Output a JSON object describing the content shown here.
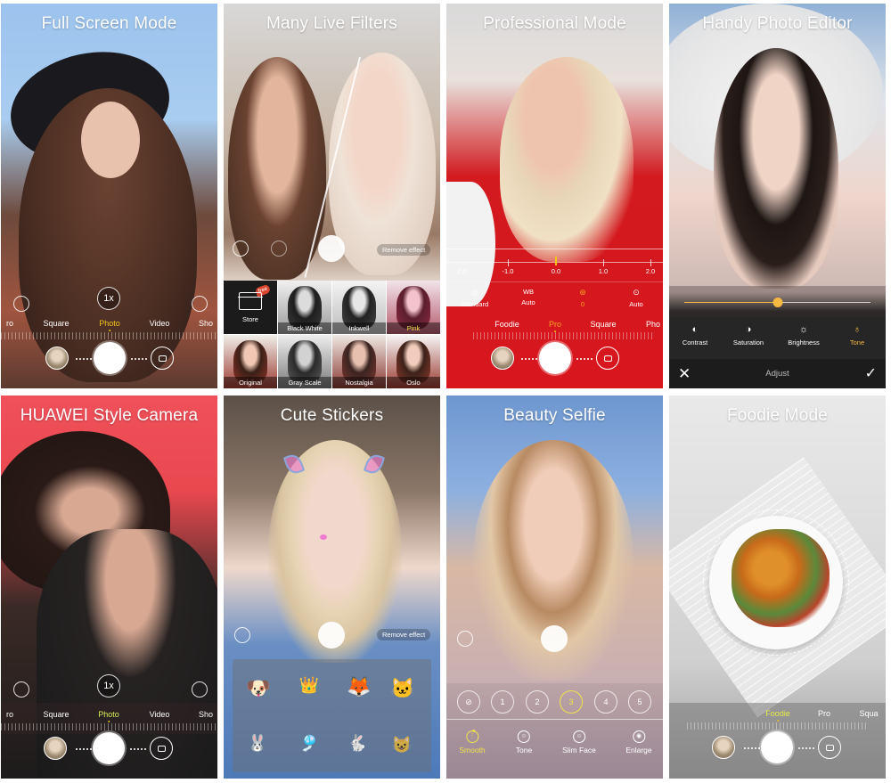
{
  "panels": [
    {
      "id": "full-screen",
      "title": "Full Screen Mode",
      "zoom_label": "1x",
      "modes": [
        "ro",
        "Square",
        "Photo",
        "Video",
        "Sho"
      ],
      "active_mode": "Photo"
    },
    {
      "id": "live-filters",
      "title": "Many Live Filters",
      "remove_effect_label": "Remove effect",
      "store": {
        "label": "Store",
        "badge": "free"
      },
      "filters": [
        {
          "label": "Black White",
          "active": false
        },
        {
          "label": "Inkwell",
          "active": false
        },
        {
          "label": "Pink",
          "active": true
        },
        {
          "label": "Original",
          "active": false
        },
        {
          "label": "Gray Scale",
          "active": false
        },
        {
          "label": "Nostalgia",
          "active": false
        },
        {
          "label": "Oslo",
          "active": false
        }
      ]
    },
    {
      "id": "pro-mode",
      "title": "Professional Mode",
      "ev_scale": [
        "-2.0",
        "-1.0",
        "0.0",
        "1.0",
        "2.0"
      ],
      "ev_value": 0.0,
      "settings": [
        {
          "icon": "metering-icon",
          "name": "",
          "value": "Standard",
          "active": false
        },
        {
          "icon": "wb-icon",
          "name": "WB",
          "value": "Auto",
          "active": false
        },
        {
          "icon": "exposure-icon",
          "name": "",
          "value": "0",
          "active": true
        },
        {
          "icon": "focus-icon",
          "name": "",
          "value": "Auto",
          "active": false
        }
      ],
      "modes": [
        "Foodie",
        "Pro",
        "Square",
        "Pho"
      ],
      "active_mode": "Pro"
    },
    {
      "id": "photo-editor",
      "title": "Handy Photo Editor",
      "slider_value": 0.5,
      "tools": [
        {
          "icon": "contrast-icon",
          "label": "Contrast",
          "active": false
        },
        {
          "icon": "saturation-icon",
          "label": "Saturation",
          "active": false
        },
        {
          "icon": "brightness-icon",
          "label": "Brightness",
          "active": false
        },
        {
          "icon": "tone-icon",
          "label": "Tone",
          "active": true
        }
      ],
      "bar_title": "Adjust"
    },
    {
      "id": "huawei-style",
      "title": "HUAWEI Style Camera",
      "zoom_label": "1x",
      "modes": [
        "ro",
        "Square",
        "Photo",
        "Video",
        "Sho"
      ],
      "active_mode": "Photo"
    },
    {
      "id": "cute-stickers",
      "title": "Cute Stickers",
      "remove_effect_label": "Remove effect",
      "stickers": [
        "dog",
        "crown",
        "fox",
        "white-cat",
        "bunny-ears",
        "pinwheel",
        "bunny-doll",
        "cat-outline"
      ]
    },
    {
      "id": "beauty-selfie",
      "title": "Beauty Selfie",
      "levels": [
        "⊘",
        "1",
        "2",
        "3",
        "4",
        "5"
      ],
      "active_level": "3",
      "tools": [
        {
          "label": "Smooth",
          "active": true
        },
        {
          "label": "Tone",
          "active": false
        },
        {
          "label": "Slim Face",
          "active": false
        },
        {
          "label": "Enlarge",
          "active": false
        }
      ]
    },
    {
      "id": "foodie-mode",
      "title": "Foodie Mode",
      "modes": [
        "Foodie",
        "Pro",
        "Squa"
      ],
      "active_mode": "Foodie"
    }
  ],
  "colors": {
    "active_yellow": "#f5c518",
    "pro_orange": "#f5a623",
    "editor_accent": "#f5b942",
    "beauty_accent": "#f0e34a"
  }
}
